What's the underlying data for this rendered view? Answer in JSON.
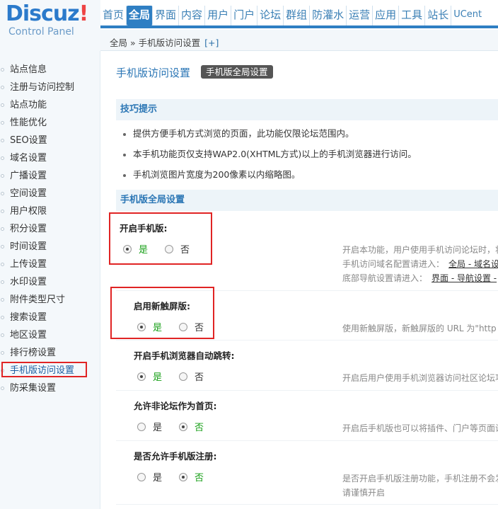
{
  "logo": {
    "main": "Discuz",
    "exclaim": "!",
    "sub": "Control Panel"
  },
  "topnav": [
    "首页",
    "全局",
    "界面",
    "内容",
    "用户",
    "门户",
    "论坛",
    "群组",
    "防灌水",
    "运营",
    "应用",
    "工具",
    "站长",
    "UCent"
  ],
  "breadcrumb": {
    "text": "全局 » 手机版访问设置",
    "plus": "[+]"
  },
  "sidebar": {
    "items": [
      "站点信息",
      "注册与访问控制",
      "站点功能",
      "性能优化",
      "SEO设置",
      "域名设置",
      "广播设置",
      "空间设置",
      "用户权限",
      "积分设置",
      "时间设置",
      "上传设置",
      "水印设置",
      "附件类型尺寸",
      "搜索设置",
      "地区设置",
      "排行榜设置",
      "手机版访问设置",
      "防采集设置"
    ],
    "active_index": 17
  },
  "main": {
    "title": "手机版访问设置",
    "badge": "手机版全局设置",
    "tips_heading": "技巧提示",
    "tips": [
      "提供方便手机方式浏览的页面，此功能仅限论坛范围内。",
      "本手机功能页仅支持WAP2.0(XHTML方式)以上的手机浏览器进行访问。",
      "手机浏览图片宽度为200像素以内缩略图。"
    ],
    "global_heading": "手机版全局设置",
    "yes": "是",
    "no": "否",
    "settings": [
      {
        "label": "开启手机版:",
        "selected": "yes",
        "desc": [
          "开启本功能，用户使用手机访问论坛时，将",
          "手机访问域名配置请进入：",
          "底部导航设置请进入："
        ],
        "links": [
          "全局 - 域名设",
          "界面 - 导航设置 -"
        ]
      },
      {
        "label": "启用新触屏版:",
        "selected": "yes",
        "desc": [
          "使用新触屏版，新触屏版的 URL 为\"http"
        ]
      },
      {
        "label": "开启手机浏览器自动跳转:",
        "selected": "yes",
        "desc": [
          "开启后用户使用手机浏览器访问社区论坛功"
        ]
      },
      {
        "label": "允许非论坛作为首页:",
        "selected": "no",
        "desc": [
          "开启后手机版也可以将插件、门户等页面设"
        ]
      },
      {
        "label": "是否允许手机版注册:",
        "selected": "no",
        "desc": [
          "是否开启手机版注册功能，手机注册不会发",
          "请谨慎开启"
        ]
      }
    ]
  }
}
